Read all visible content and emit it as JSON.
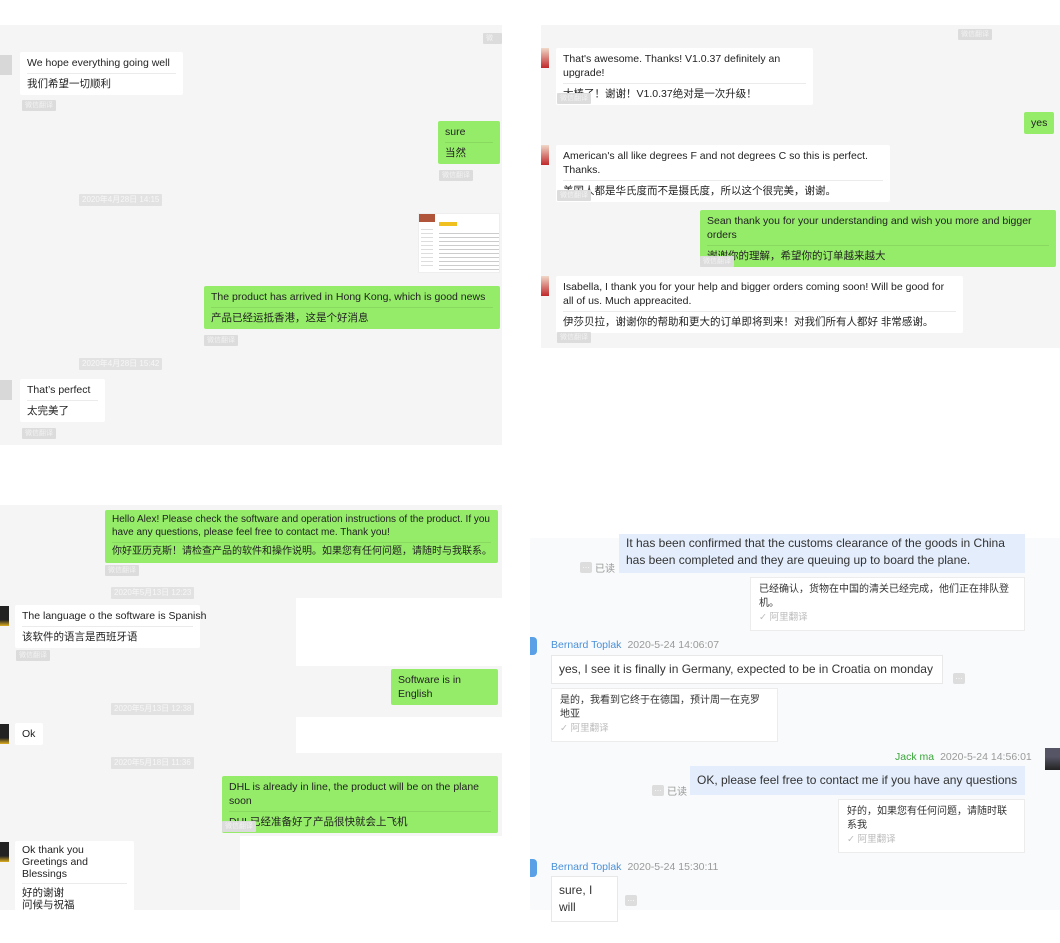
{
  "translate_tag": "微信翻译",
  "read_label": "已读",
  "ali_translate": "✓ 阿里翻译",
  "colors": {
    "sent_bubble": "#95ec69",
    "received_bubble": "#ffffff",
    "chat_bg": "#f5f5f5",
    "name_blue": "#4a90d9",
    "name_green": "#3aa53a",
    "sent_light_blue": "#e3edfb"
  },
  "panel1": {
    "m1": {
      "en": "We hope everything going well",
      "cn": "我们希望一切顺利"
    },
    "m2": {
      "en": "sure",
      "cn": "当然"
    },
    "ts1": "2020年4月28日 14:15",
    "m3": {
      "en": "The product has arrived in Hong Kong, which is good news",
      "cn": "产品已经运抵香港，这是个好消息"
    },
    "ts2": "2020年4月28日 15:42",
    "m4": {
      "en": "That’s perfect",
      "cn": "太完美了"
    }
  },
  "panel2": {
    "m1": {
      "en": "That's awesome. Thanks! V1.0.37 definitely an upgrade!",
      "cn": "太棒了！谢谢！V1.0.37绝对是一次升级！"
    },
    "m2": {
      "en": "yes"
    },
    "m3": {
      "en": "American's all like degrees F and not degrees C so this is perfect. Thanks.",
      "cn": "美国人都是华氏度而不是摄氏度，所以这个很完美，谢谢。"
    },
    "m4": {
      "en": "Sean thank you for your understanding and wish you more and bigger orders",
      "cn": "谢谢你的理解，希望你的订单越来越大"
    },
    "m5": {
      "en": "Isabella, I thank you for your help and bigger orders coming soon! Will be good for all of us. Much appreacited.",
      "cn": "伊莎贝拉，谢谢你的帮助和更大的订单即将到来！对我们所有人都好 非常感谢。"
    }
  },
  "panel3": {
    "m1": {
      "en": "Hello Alex! Please check the software and operation instructions of the product. If you have any questions, please feel free to contact me. Thank you!",
      "cn": "你好亚历克斯！请检查产品的软件和操作说明。如果您有任何问题，请随时与我联系。谢谢你"
    },
    "ts1": "2020年5月13日 12:23",
    "m2": {
      "en_a": "The language o",
      "en_b": "the software is Spanish",
      "cn_a": "该软件的语言是西",
      "cn_b": "班牙语"
    },
    "m3": {
      "en": "Software is in English"
    },
    "ts2": "2020年5月13日 12:38",
    "m4": {
      "en": "Ok"
    },
    "ts3": "2020年5月18日 11:36",
    "m5": {
      "en": "DHL is already in line, the product will be on the plane soon",
      "cn": "DHL已经准备好了产品很快就会上飞机"
    },
    "m6": {
      "en1": "Ok thank you",
      "en2": "Greetings and Blessings",
      "cn1": "好的谢谢",
      "cn2": "问候与祝福"
    }
  },
  "panel4": {
    "m1": {
      "en": "It has been confirmed that the customs clearance of the goods in China has been completed and they are queuing up to board the plane.",
      "cn": "已经确认，货物在中国的清关已经完成，他们正在排队登机。"
    },
    "m2": {
      "name": "Bernard Toplak",
      "time": "2020-5-24 14:06:07",
      "en": "yes, I see it is finally in Germany, expected to be in Croatia on monday",
      "cn": "是的，我看到它终于在德国，预计周一在克罗地亚"
    },
    "m3": {
      "name": "Jack ma",
      "time": "2020-5-24 14:56:01",
      "en": "OK, please feel free to contact me if you have any questions",
      "cn": "好的，如果您有任何问题，请随时联系我"
    },
    "m4": {
      "name": "Bernard Toplak",
      "time": "2020-5-24 15:30:11",
      "en": "sure, I will"
    }
  }
}
